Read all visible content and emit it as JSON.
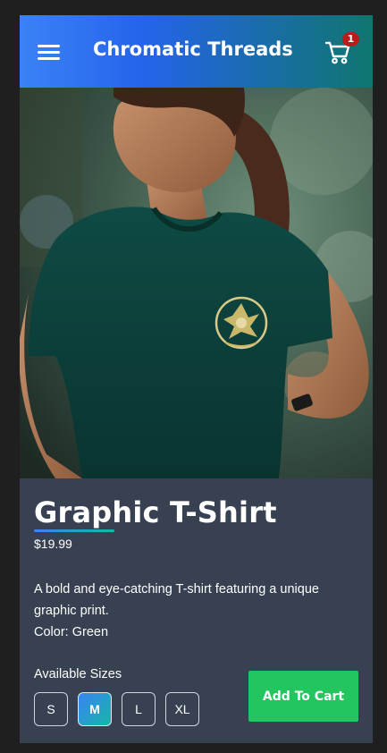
{
  "header": {
    "brand": "Chromatic Threads",
    "cart_count": "1",
    "menu_icon": "hamburger-menu-icon",
    "cart_icon": "shopping-cart-icon"
  },
  "product": {
    "image_alt": "Woman wearing a dark green graphic T-shirt",
    "title": "Graphic T-Shirt",
    "price": "$19.99",
    "description": "A bold and eye-catching T-shirt featuring a unique graphic print.",
    "color_line": "Color: Green"
  },
  "sizes": {
    "label": "Available Sizes",
    "options": [
      "S",
      "M",
      "L",
      "XL"
    ],
    "selected": "M"
  },
  "actions": {
    "add_to_cart": "Add To Cart"
  },
  "colors": {
    "header_start": "#3b82f6",
    "header_end": "#0f766e",
    "panel": "#374151",
    "add_button": "#22c55e",
    "badge": "#b91c1c"
  }
}
